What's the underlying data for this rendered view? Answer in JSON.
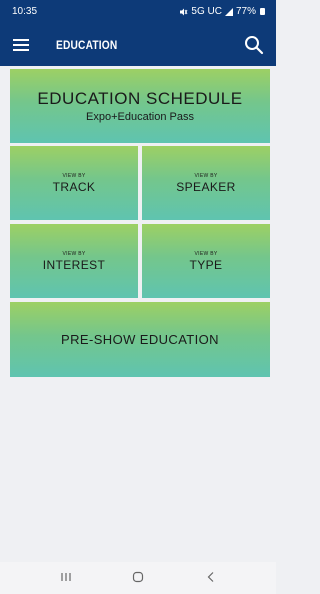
{
  "status_bar": {
    "time": "10:35",
    "indicators": "5G UC",
    "battery": "77%",
    "icons": [
      "mute-icon",
      "signal-icon",
      "battery-icon"
    ]
  },
  "app_bar": {
    "title": "EDUCATION",
    "menu_icon": "hamburger-menu-icon",
    "search_icon": "search-icon",
    "background_color": "#0d3a78"
  },
  "tiles": {
    "schedule": {
      "title": "EDUCATION SCHEDULE",
      "subtitle": "Expo+Education Pass"
    },
    "track": {
      "prefix": "VIEW BY",
      "label": "TRACK"
    },
    "speaker": {
      "prefix": "VIEW BY",
      "label": "SPEAKER"
    },
    "interest": {
      "prefix": "VIEW BY",
      "label": "INTEREST"
    },
    "type": {
      "prefix": "VIEW BY",
      "label": "TYPE"
    },
    "preshow": {
      "label": "PRE-SHOW EDUCATION"
    }
  },
  "colors": {
    "tile_gradient_top": "#9dd064",
    "tile_gradient_bottom": "#5fc4b0",
    "page_background": "#eff0f3"
  },
  "nav_bar": {
    "icons": [
      "recent-apps-icon",
      "home-icon",
      "back-icon"
    ]
  }
}
